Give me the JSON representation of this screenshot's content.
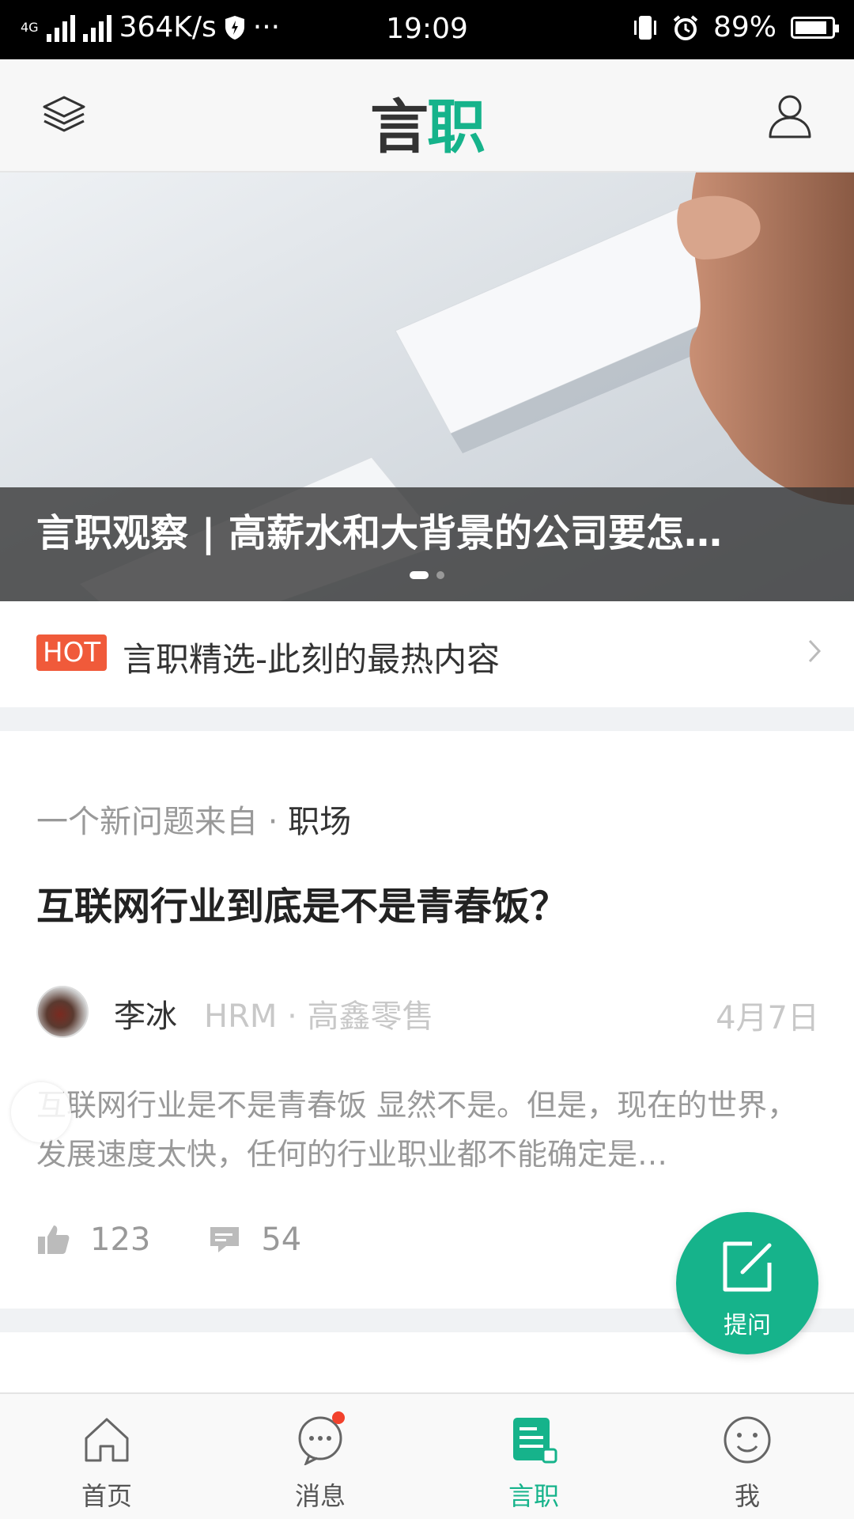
{
  "status_bar": {
    "network": "4G",
    "speed": "364K/s",
    "more": "···",
    "time": "19:09",
    "battery": "89%",
    "battery_level": 0.89
  },
  "header": {
    "logo_part1": "言",
    "logo_part2": "职"
  },
  "banner": {
    "caption": "言职观察 | 高薪水和大背景的公司要怎…",
    "slide_count": 2,
    "active_slide": 1
  },
  "hot": {
    "badge": "HOT",
    "text": "言职精选-此刻的最热内容"
  },
  "card": {
    "from_prefix": "一个新问题来自 · ",
    "category": "职场",
    "title": "互联网行业到底是不是青春饭？",
    "author_name": "李冰",
    "author_role": "HRM · 高鑫零售",
    "date": "4月7日",
    "excerpt": "互联网行业是不是青春饭 显然不是。但是，现在的世界，发展速度太快，任何的行业职业都不能确定是…",
    "likes": "123",
    "comments": "54"
  },
  "fab": {
    "label": "提问"
  },
  "bottom_nav": {
    "items": [
      {
        "label": "首页",
        "icon": "home-icon"
      },
      {
        "label": "消息",
        "icon": "message-icon"
      },
      {
        "label": "言职",
        "icon": "yanzhi-icon"
      },
      {
        "label": "我",
        "icon": "smile-icon"
      }
    ],
    "active_index": 2
  },
  "colors": {
    "accent": "#16b38b",
    "hot": "#f05a3a",
    "notify": "#f2412c"
  }
}
